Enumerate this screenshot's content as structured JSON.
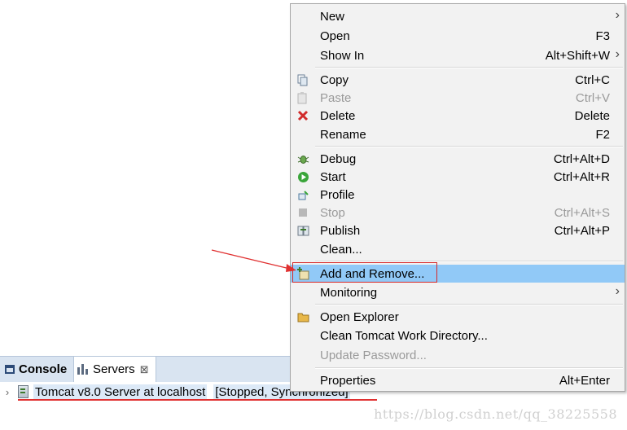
{
  "panel": {
    "tabs": [
      {
        "label": "Console",
        "icon": "console-icon"
      },
      {
        "label": "Servers",
        "icon": "servers-icon",
        "close": "⊠"
      }
    ],
    "server": {
      "expander": "›",
      "name": "Tomcat v8.0 Server at localhost",
      "state": "[Stopped, Synchronized]"
    }
  },
  "menu": {
    "items": [
      {
        "label": "New",
        "shortcut": "",
        "submenu": true
      },
      {
        "label": "Open",
        "shortcut": "F3"
      },
      {
        "label": "Show In",
        "shortcut": "Alt+Shift+W",
        "submenu": true
      },
      {
        "label": "Copy",
        "shortcut": "Ctrl+C",
        "icon": "copy-icon"
      },
      {
        "label": "Paste",
        "shortcut": "Ctrl+V",
        "icon": "paste-icon",
        "disabled": true
      },
      {
        "label": "Delete",
        "shortcut": "Delete",
        "icon": "delete-icon"
      },
      {
        "label": "Rename",
        "shortcut": "F2"
      },
      {
        "label": "Debug",
        "shortcut": "Ctrl+Alt+D",
        "icon": "debug-icon"
      },
      {
        "label": "Start",
        "shortcut": "Ctrl+Alt+R",
        "icon": "start-icon"
      },
      {
        "label": "Profile",
        "shortcut": "",
        "icon": "profile-icon"
      },
      {
        "label": "Stop",
        "shortcut": "Ctrl+Alt+S",
        "icon": "stop-icon",
        "disabled": true
      },
      {
        "label": "Publish",
        "shortcut": "Ctrl+Alt+P",
        "icon": "publish-icon"
      },
      {
        "label": "Clean...",
        "shortcut": ""
      },
      {
        "label": "Add and Remove...",
        "shortcut": "",
        "icon": "add-remove-icon",
        "highlighted": true
      },
      {
        "label": "Monitoring",
        "shortcut": "",
        "submenu": true
      },
      {
        "label": "Open Explorer",
        "shortcut": "",
        "icon": "folder-icon"
      },
      {
        "label": "Clean Tomcat Work Directory...",
        "shortcut": ""
      },
      {
        "label": "Update Password...",
        "shortcut": "",
        "disabled": true
      },
      {
        "label": "Properties",
        "shortcut": "Alt+Enter"
      }
    ]
  },
  "colors": {
    "highlight": "#91c9f7",
    "annotation_red": "#e03030"
  },
  "watermark": "https://blog.csdn.net/qq_38225558"
}
